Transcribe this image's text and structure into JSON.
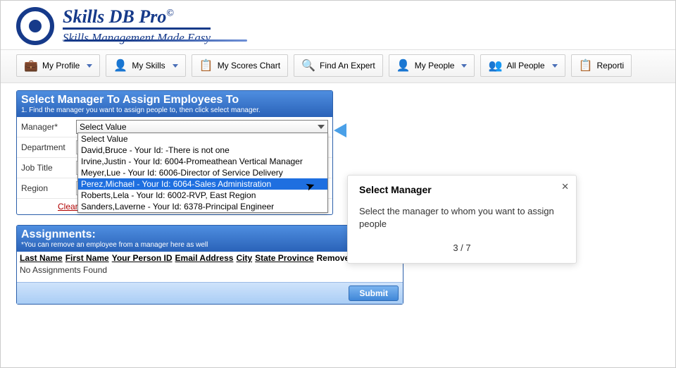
{
  "brand": {
    "title": "Skills DB Pro",
    "copyright": "©",
    "tagline": "Skills Management Made Easy"
  },
  "nav": [
    {
      "icon": "💼",
      "label": "My Profile",
      "caret": true
    },
    {
      "icon": "👤",
      "label": "My Skills",
      "caret": true
    },
    {
      "icon": "📋",
      "label": "My Scores Chart",
      "caret": false
    },
    {
      "icon": "🔍",
      "label": "Find An Expert",
      "caret": false
    },
    {
      "icon": "👤",
      "label": "My People",
      "caret": true
    },
    {
      "icon": "👥",
      "label": "All People",
      "caret": true
    },
    {
      "icon": "📋",
      "label": "Reporti",
      "caret": false
    }
  ],
  "panel1": {
    "title": "Select Manager To Assign Employees To",
    "hint": "1. Find the manager you want to assign people to, then click select manager.",
    "fields": {
      "manager_label": "Manager*",
      "department_label": "Department",
      "jobtitle_label": "Job Title",
      "region_label": "Region"
    },
    "manager_selected": "Select Value",
    "manager_options": [
      "Select Value",
      "David,Bruce - Your Id: -There is not one",
      "Irvine,Justin - Your Id: 6004-Promeathean Vertical Manager",
      "Meyer,Lue - Your Id: 6006-Director of Service Delivery",
      "Perez,Michael - Your Id: 6064-Sales Administration",
      "Roberts,Lela - Your Id: 6002-RVP, East Region",
      "Sanders,Laverne - Your Id: 6378-Principal Engineer"
    ],
    "manager_hover_index": 4,
    "clear": "Clear"
  },
  "assign": {
    "title": "Assignments:",
    "hint": "*You can remove an employee from a manager here as well",
    "cols": [
      "Last Name",
      "First Name",
      "Your Person ID",
      "Email Address",
      "City",
      "State Province",
      "Remove"
    ],
    "empty": "No Assignments Found",
    "submit": "Submit"
  },
  "tip": {
    "title": "Select Manager",
    "body": "Select the manager to whom you want to assign people",
    "step": "3 / 7"
  }
}
